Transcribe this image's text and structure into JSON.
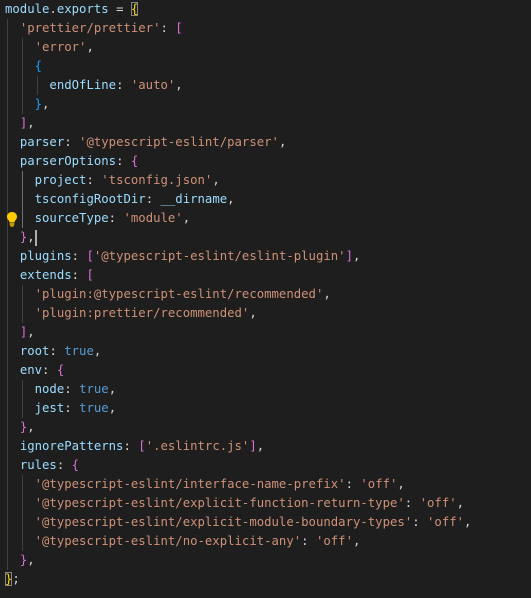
{
  "editor": {
    "language": "javascript",
    "lines": [
      "module.exports = {",
      "  'prettier/prettier': [",
      "    'error',",
      "    {",
      "      endOfLine: 'auto',",
      "    },",
      "  ],",
      "  parser: '@typescript-eslint/parser',",
      "  parserOptions: {",
      "    project: 'tsconfig.json',",
      "    tsconfigRootDir: __dirname,",
      "    sourceType: 'module',",
      "  },",
      "  plugins: ['@typescript-eslint/eslint-plugin'],",
      "  extends: [",
      "    'plugin:@typescript-eslint/recommended',",
      "    'plugin:prettier/recommended',",
      "  ],",
      "  root: true,",
      "  env: {",
      "    node: true,",
      "    jest: true,",
      "  },",
      "  ignorePatterns: ['.eslintrc.js'],",
      "  rules: {",
      "    '@typescript-eslint/interface-name-prefix': 'off',",
      "    '@typescript-eslint/explicit-function-return-type': 'off',",
      "    '@typescript-eslint/explicit-module-boundary-types': 'off',",
      "    '@typescript-eslint/no-explicit-any': 'off',",
      "  },",
      "};"
    ],
    "cursor_line": 13,
    "lightbulb_line": 12,
    "lightbulb_icon": "lightbulb-icon",
    "colors": {
      "background": "#1e1e1e",
      "property": "#9cdcfe",
      "string": "#ce9178",
      "keyword": "#569cd6",
      "bracket_level1": "#ffd700",
      "bracket_level2": "#da70d6",
      "bracket_level3": "#179fff",
      "lightbulb": "#ffcc00"
    }
  }
}
